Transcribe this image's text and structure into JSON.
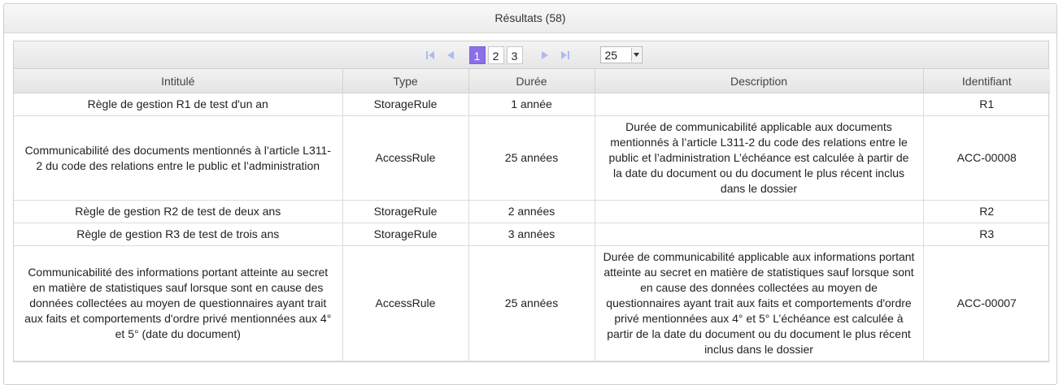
{
  "panel": {
    "title": "Résultats (58)"
  },
  "paginator": {
    "first_icon": "first-page-icon",
    "prev_icon": "previous-page-icon",
    "next_icon": "next-page-icon",
    "last_icon": "last-page-icon",
    "pages": [
      "1",
      "2",
      "3"
    ],
    "active_page": "1",
    "rows_per_page": "25",
    "accent_color": "#8b6fe6"
  },
  "table": {
    "headers": [
      "Intitulé",
      "Type",
      "Durée",
      "Description",
      "Identifiant"
    ],
    "rows": [
      {
        "intitule": "Règle de gestion R1 de test d'un an",
        "type": "StorageRule",
        "duree": "1 année",
        "description": "",
        "identifiant": "R1"
      },
      {
        "intitule": "Communicabilité des documents mentionnés à l’article L311-2 du code des relations entre le public et l’administration",
        "type": "AccessRule",
        "duree": "25 années",
        "description": "Durée de communicabilité applicable aux documents mentionnés à l’article L311-2 du code des relations entre le public et l’administration L’échéance est calculée à partir de la date du document ou du document le plus récent inclus dans le dossier",
        "identifiant": "ACC-00008"
      },
      {
        "intitule": "Règle de gestion R2 de test de deux ans",
        "type": "StorageRule",
        "duree": "2 années",
        "description": "",
        "identifiant": "R2"
      },
      {
        "intitule": "Règle de gestion R3 de test de trois ans",
        "type": "StorageRule",
        "duree": "3 années",
        "description": "",
        "identifiant": "R3"
      },
      {
        "intitule": "Communicabilité des informations portant atteinte au secret en matière de statistiques sauf lorsque sont en cause des données collectées au moyen de questionnaires ayant trait aux faits et comportements d'ordre privé mentionnées aux 4° et 5° (date du document)",
        "type": "AccessRule",
        "duree": "25 années",
        "description": "Durée de communicabilité applicable aux informations portant atteinte au secret en matière de statistiques sauf lorsque sont en cause des données collectées au moyen de questionnaires ayant trait aux faits et comportements d'ordre privé mentionnées aux 4° et 5° L’échéance est calculée à partir de la date du document ou du document le plus récent inclus dans le dossier",
        "identifiant": "ACC-00007"
      }
    ]
  }
}
